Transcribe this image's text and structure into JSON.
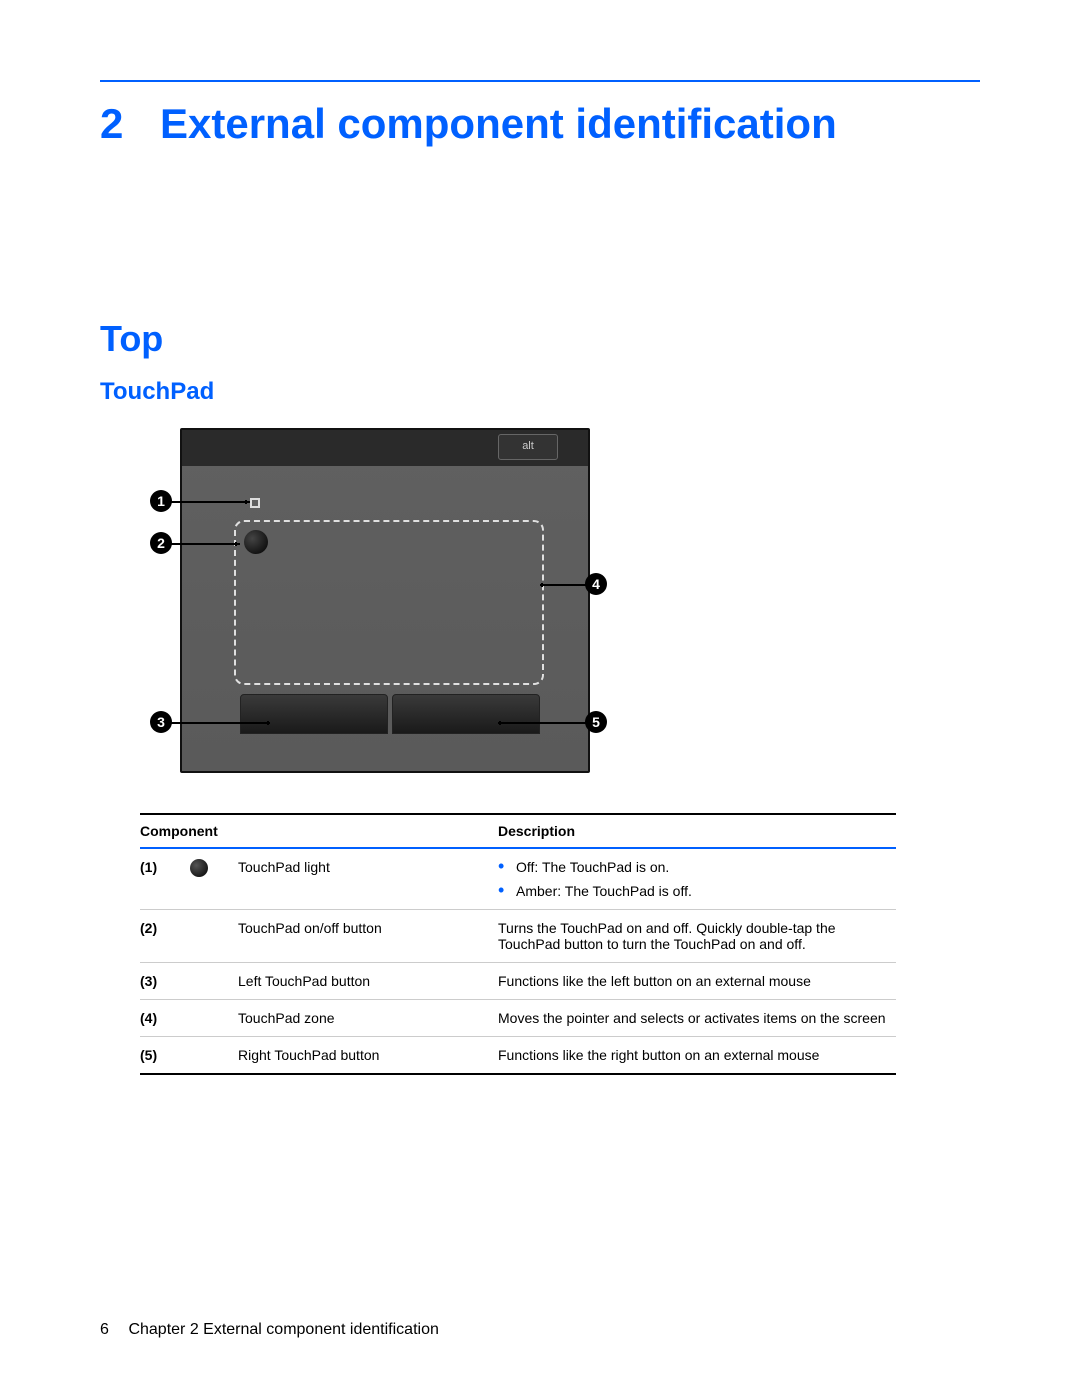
{
  "chapter": {
    "number": "2",
    "title": "External component identification"
  },
  "section": {
    "title": "Top"
  },
  "subsection": {
    "title": "TouchPad"
  },
  "diagram": {
    "alt_key": "alt",
    "callouts": {
      "c1": "1",
      "c2": "2",
      "c3": "3",
      "c4": "4",
      "c5": "5"
    }
  },
  "table": {
    "headers": {
      "component": "Component",
      "description": "Description"
    },
    "rows": [
      {
        "id": "(1)",
        "has_icon": true,
        "component": "TouchPad light",
        "bullets": [
          "Off: The TouchPad is on.",
          "Amber: The TouchPad is off."
        ]
      },
      {
        "id": "(2)",
        "component": "TouchPad on/off button",
        "description": "Turns the TouchPad on and off. Quickly double-tap the TouchPad button to turn the TouchPad on and off."
      },
      {
        "id": "(3)",
        "component": "Left TouchPad button",
        "description": "Functions like the left button on an external mouse"
      },
      {
        "id": "(4)",
        "component": "TouchPad zone",
        "description": "Moves the pointer and selects or activates items on the screen"
      },
      {
        "id": "(5)",
        "component": "Right TouchPad button",
        "description": "Functions like the right button on an external mouse"
      }
    ]
  },
  "footer": {
    "page_number": "6",
    "text": "Chapter 2   External component identification"
  }
}
